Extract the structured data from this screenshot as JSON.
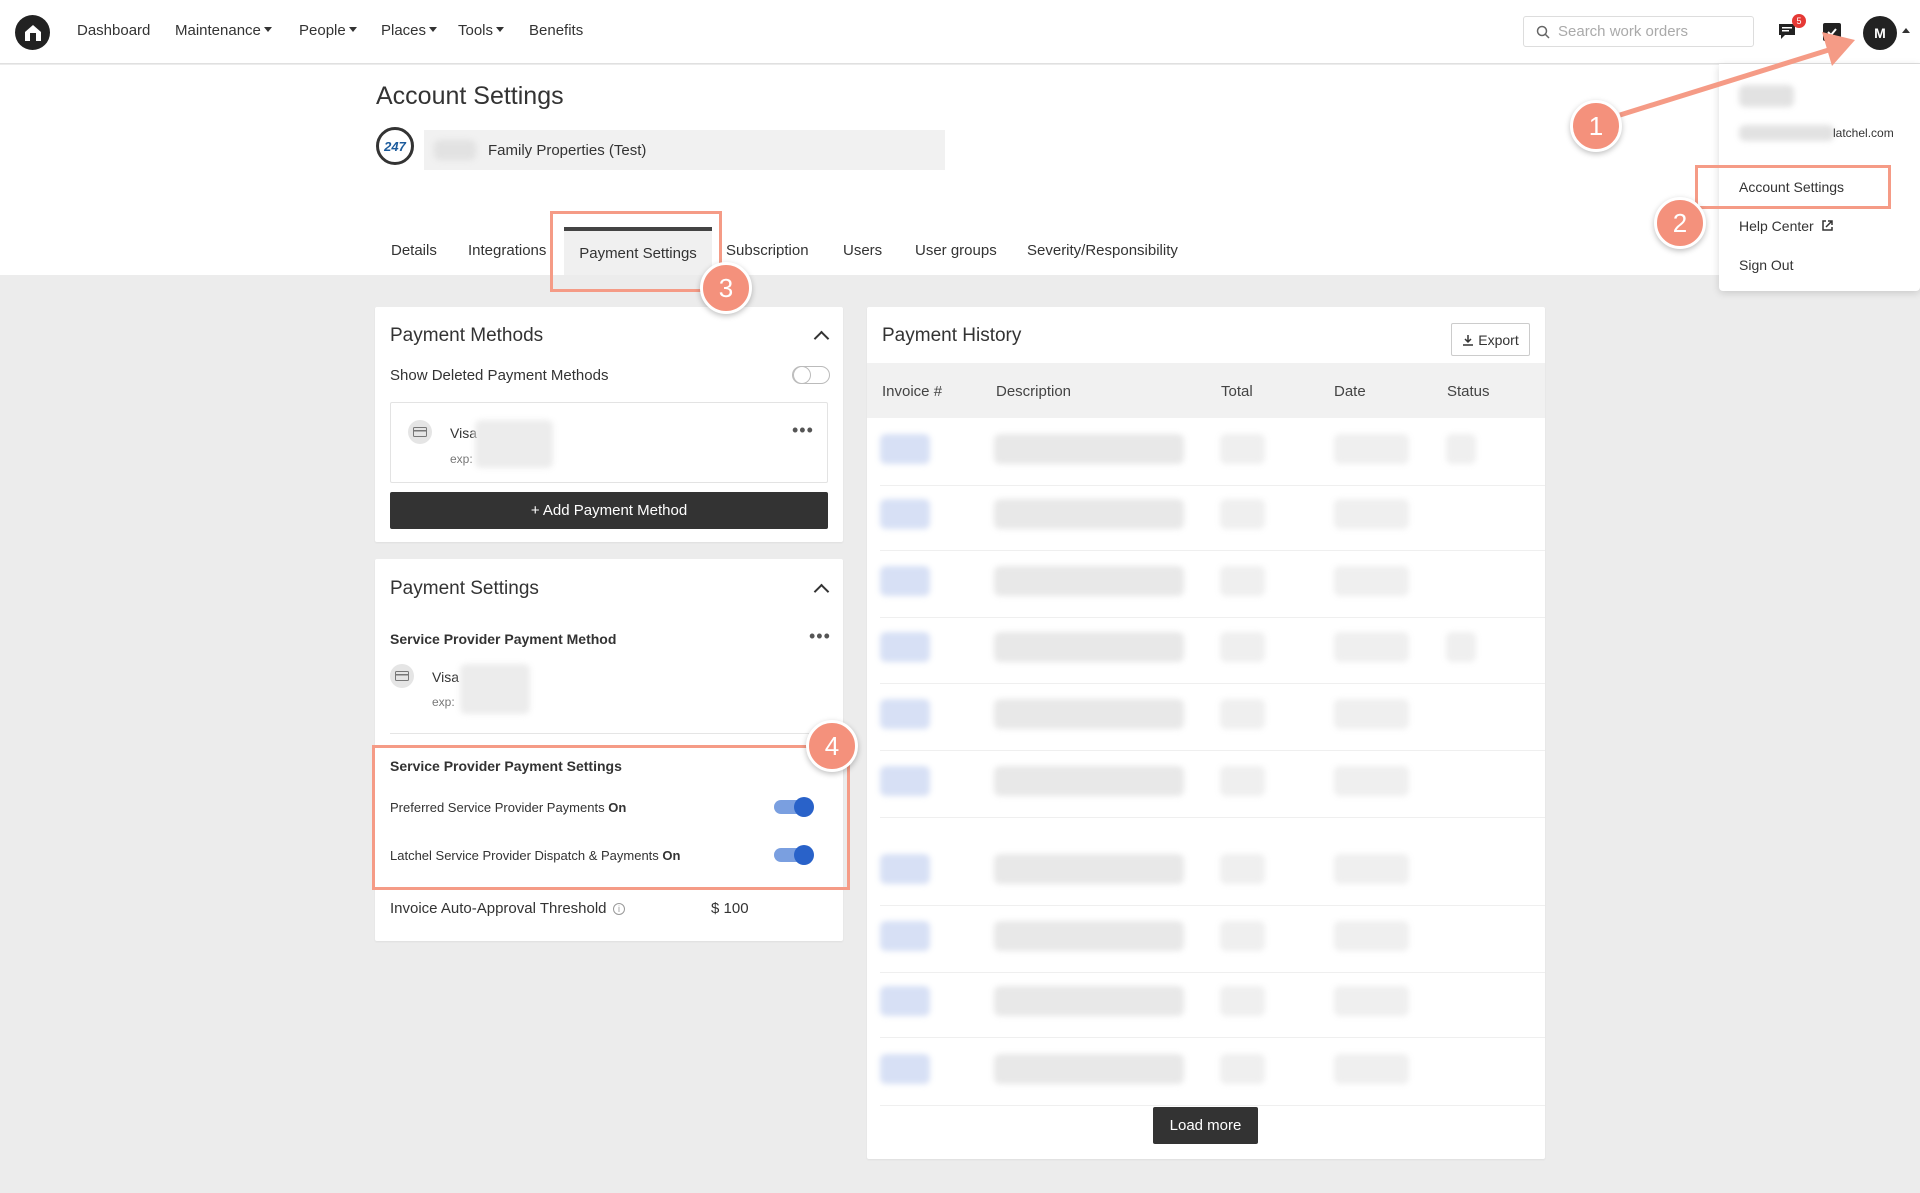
{
  "nav": {
    "items": [
      {
        "label": "Dashboard",
        "dropdown": false
      },
      {
        "label": "Maintenance",
        "dropdown": true
      },
      {
        "label": "People",
        "dropdown": true
      },
      {
        "label": "Places",
        "dropdown": true
      },
      {
        "label": "Tools",
        "dropdown": true
      },
      {
        "label": "Benefits",
        "dropdown": false
      }
    ],
    "search_placeholder": "Search work orders",
    "notification_count": "5",
    "avatar_initial": "M"
  },
  "header": {
    "title": "Account Settings",
    "account_logo_text": "247",
    "account_name": "Family Properties (Test)"
  },
  "tabs": {
    "details": "Details",
    "integrations": "Integrations",
    "payment_settings": "Payment Settings",
    "subscription": "Subscription",
    "users": "Users",
    "user_groups": "User groups",
    "severity": "Severity/Responsibility"
  },
  "payment_methods": {
    "title": "Payment Methods",
    "show_deleted_label": "Show Deleted Payment Methods",
    "show_deleted_on": false,
    "card_brand": "Visa",
    "card_exp_label": "exp:",
    "more": "•••",
    "add_button": "+ Add Payment Method"
  },
  "payment_settings": {
    "title": "Payment Settings",
    "sp_method_title": "Service Provider Payment Method",
    "card_brand": "Visa",
    "card_exp_label": "exp:",
    "more": "•••",
    "sp_settings_title": "Service Provider Payment Settings",
    "preferred_label": "Preferred Service Provider Payments",
    "preferred_state": "On",
    "dispatch_label": "Latchel Service Provider Dispatch & Payments",
    "dispatch_state": "On",
    "threshold_label": "Invoice Auto-Approval Threshold",
    "threshold_value": "$ 100"
  },
  "payment_history": {
    "title": "Payment History",
    "export_label": "Export",
    "columns": [
      "Invoice #",
      "Description",
      "Total",
      "Date",
      "Status"
    ],
    "load_more": "Load more"
  },
  "user_menu": {
    "email_suffix": "latchel.com",
    "account_settings": "Account Settings",
    "help_center": "Help Center",
    "sign_out": "Sign Out"
  },
  "annotations": [
    "1",
    "2",
    "3",
    "4"
  ],
  "colors": {
    "annotation": "#f4917c",
    "toggle_on": "#2962c9",
    "dark_button": "#333333"
  }
}
